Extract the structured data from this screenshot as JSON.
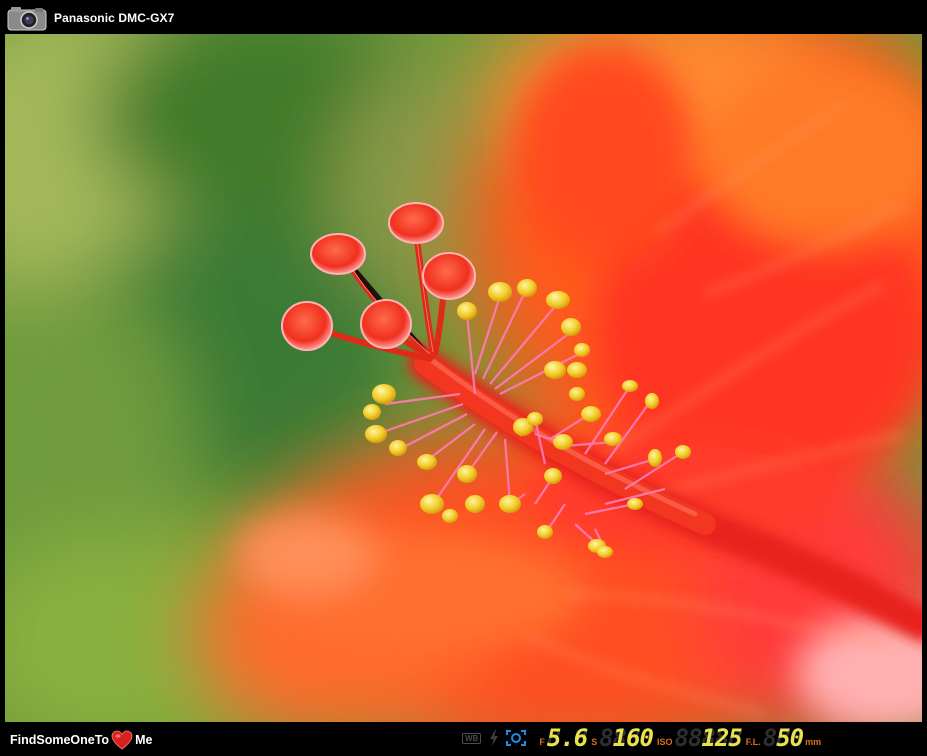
{
  "header": {
    "camera_model": "Panasonic DMC-GX7",
    "camera_icon": "camera-icon"
  },
  "photo": {
    "subject_icon": "hibiscus-flower-photo"
  },
  "footer": {
    "brand_left": "FindSomeOneTo",
    "brand_right": "Me",
    "heart_icon": "heart-icon"
  },
  "exif": {
    "wb_label": "WB",
    "aperture_label": "F",
    "aperture_ghost": "8.8",
    "aperture_value": "5.6",
    "shutter_label": "S",
    "shutter_ghost": "8888",
    "shutter_value": "160",
    "iso_label": "ISO",
    "iso_ghost": "88888",
    "iso_value": "125",
    "fl_label": "F.L.",
    "fl_ghost": "888",
    "fl_value": "50",
    "fl_unit": "mm",
    "colors": {
      "digits": "#e9e24c",
      "labels": "#e06a1c",
      "ghost": "#2e2e2e",
      "meter_icon": "#1e8ce6"
    }
  }
}
